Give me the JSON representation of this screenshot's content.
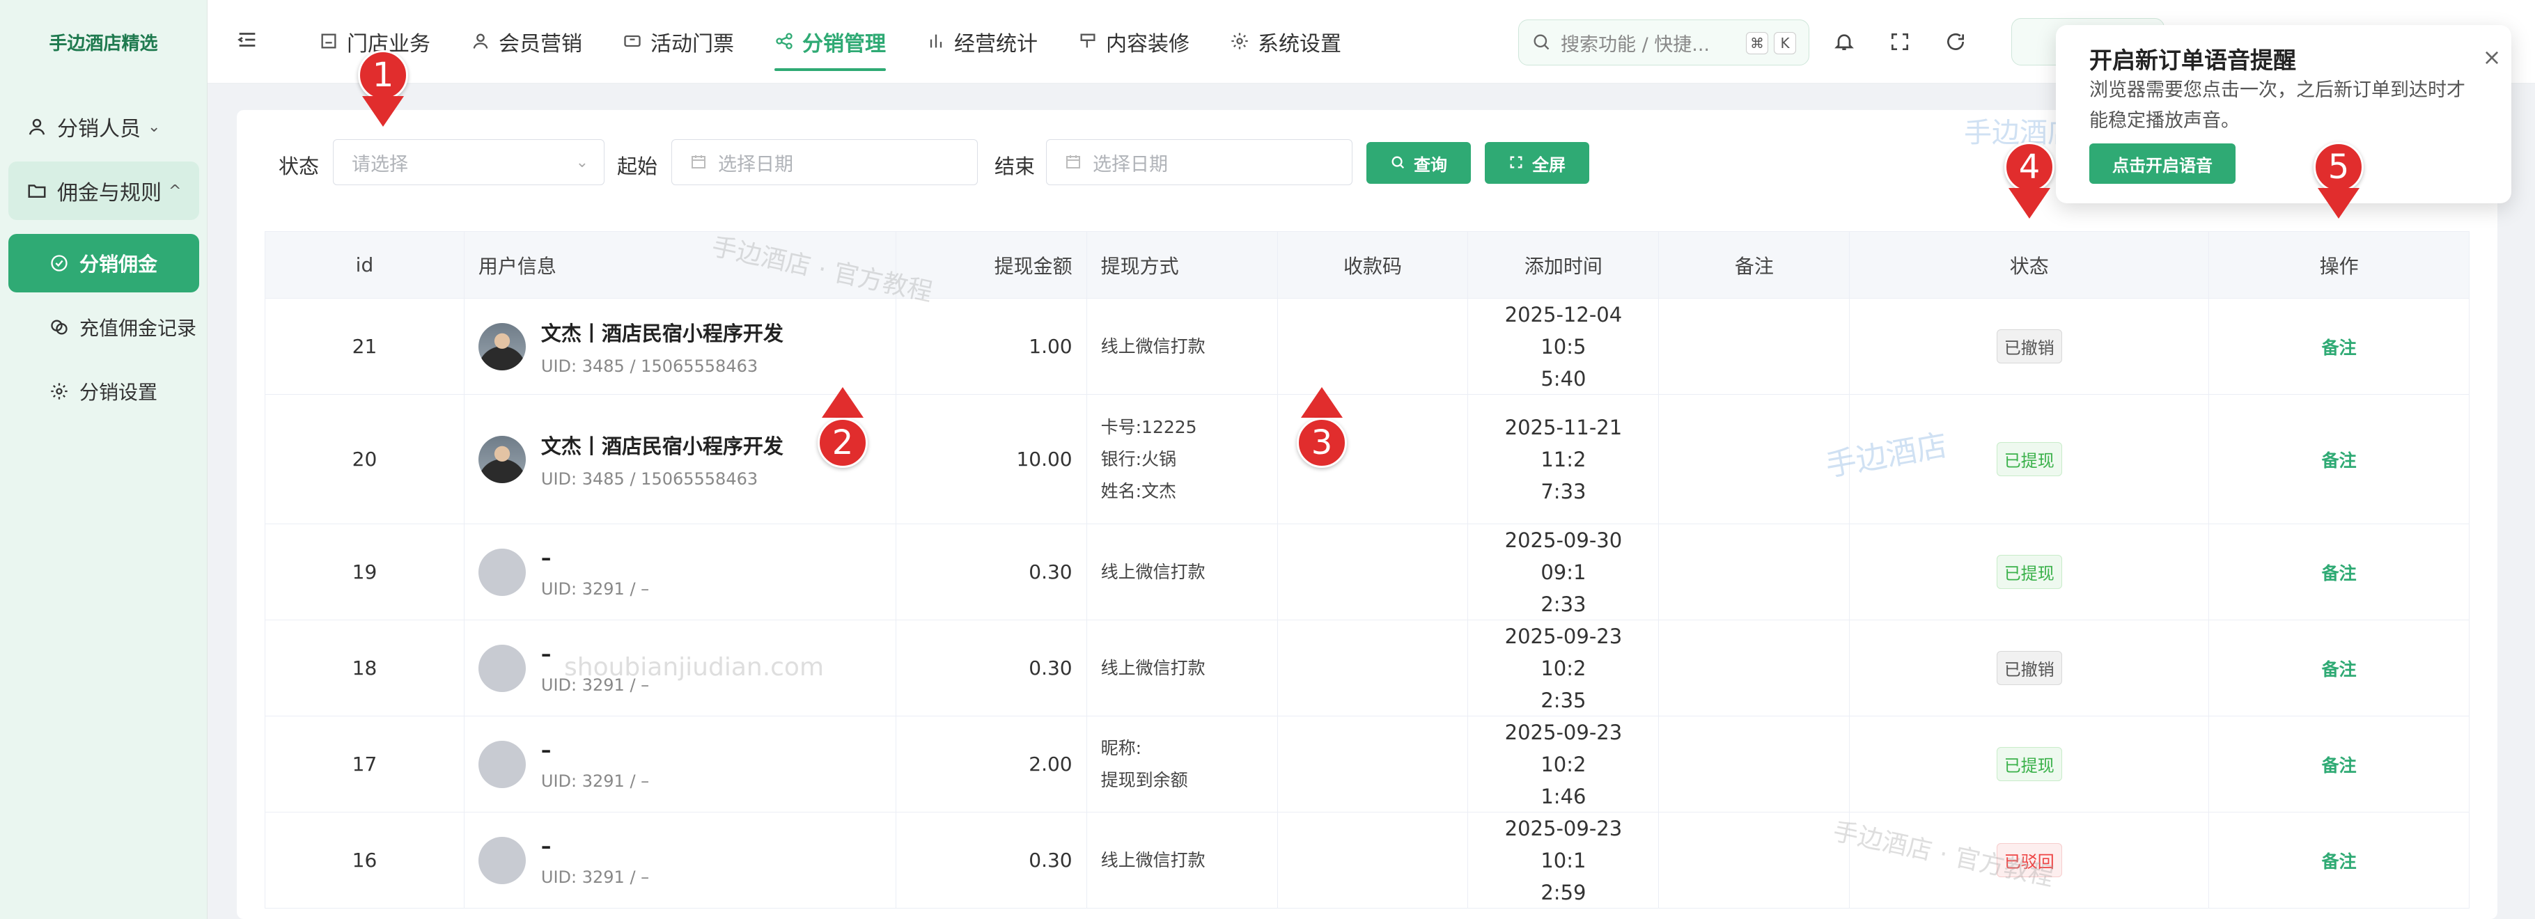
{
  "sidebar": {
    "brand": "手边酒店精选",
    "items": [
      {
        "label": "分销人员",
        "icon": "user-icon"
      },
      {
        "label": "佣金与规则",
        "icon": "folder-icon"
      },
      {
        "label": "分销佣金",
        "icon": "check-circle-icon"
      },
      {
        "label": "充值佣金记录",
        "icon": "coins-icon"
      },
      {
        "label": "分销设置",
        "icon": "gear-icon"
      }
    ],
    "group_chevron": "^",
    "first_chevron": "⌄"
  },
  "topnav": {
    "items": [
      {
        "label": "门店业务",
        "icon": "store-icon"
      },
      {
        "label": "会员营销",
        "icon": "user-icon"
      },
      {
        "label": "活动门票",
        "icon": "ticket-icon"
      },
      {
        "label": "分销管理",
        "icon": "share-icon"
      },
      {
        "label": "经营统计",
        "icon": "bar-chart-icon"
      },
      {
        "label": "内容装修",
        "icon": "brush-icon"
      },
      {
        "label": "系统设置",
        "icon": "gear-icon"
      }
    ],
    "active_index": 3,
    "search": {
      "placeholder": "搜索功能 / 快捷...",
      "kbd1": "⌘",
      "kbd2": "K"
    }
  },
  "filters": {
    "status_label": "状态",
    "status_placeholder": "请选择",
    "start_label": "起始",
    "start_placeholder": "选择日期",
    "end_label": "结束",
    "end_placeholder": "选择日期",
    "query_button": "查询",
    "fullscreen_button": "全屏"
  },
  "table": {
    "headers": [
      "id",
      "用户信息",
      "提现金额",
      "提现方式",
      "收款码",
      "添加时间",
      "备注",
      "状态",
      "操作"
    ],
    "rows": [
      {
        "id": "21",
        "name": "文杰丨酒店民宿小程序开发",
        "uid": "UID: 3485 / 15065558463",
        "amount": "1.00",
        "method1": "线上微信打款",
        "method2": "",
        "method3": "",
        "time1": "2025-12-04 10:5",
        "time2": "5:40",
        "status": "已撤销",
        "status_type": "revoked",
        "action": "备注",
        "photo": true
      },
      {
        "id": "20",
        "name": "文杰丨酒店民宿小程序开发",
        "uid": "UID: 3485 / 15065558463",
        "amount": "10.00",
        "method1": "卡号:12225",
        "method2": "银行:火锅",
        "method3": "姓名:文杰",
        "time1": "2025-11-21 11:2",
        "time2": "7:33",
        "status": "已提现",
        "status_type": "withdrawn",
        "action": "备注",
        "photo": true
      },
      {
        "id": "19",
        "name": "–",
        "uid": "UID: 3291 / –",
        "amount": "0.30",
        "method1": "线上微信打款",
        "method2": "",
        "method3": "",
        "time1": "2025-09-30 09:1",
        "time2": "2:33",
        "status": "已提现",
        "status_type": "withdrawn",
        "action": "备注",
        "photo": false
      },
      {
        "id": "18",
        "name": "–",
        "uid": "UID: 3291 / –",
        "amount": "0.30",
        "method1": "线上微信打款",
        "method2": "",
        "method3": "",
        "time1": "2025-09-23 10:2",
        "time2": "2:35",
        "status": "已撤销",
        "status_type": "revoked",
        "action": "备注",
        "photo": false
      },
      {
        "id": "17",
        "name": "–",
        "uid": "UID: 3291 / –",
        "amount": "2.00",
        "method1": "昵称:",
        "method2": "提现到余额",
        "method3": "",
        "time1": "2025-09-23 10:2",
        "time2": "1:46",
        "status": "已提现",
        "status_type": "withdrawn",
        "action": "备注",
        "photo": false
      },
      {
        "id": "16",
        "name": "–",
        "uid": "UID: 3291 / –",
        "amount": "0.30",
        "method1": "线上微信打款",
        "method2": "",
        "method3": "",
        "time1": "2025-09-23 10:1",
        "time2": "2:59",
        "status": "已驳回",
        "status_type": "rejected",
        "action": "备注",
        "photo": false
      }
    ]
  },
  "toast": {
    "title": "开启新订单语音提醒",
    "body": "浏览器需要您点击一次，之后新订单到达时才能稳定播放声音。",
    "button": "点击开启语音",
    "close": "×"
  },
  "watermarks": {
    "w1": "手边酒店 · 官方教程",
    "w2": "shoubianjiudian.com",
    "w3": "手边酒店",
    "w4": "手边酒店 · 官方教程",
    "w5": "手边酒店"
  },
  "markers": [
    "1",
    "2",
    "3",
    "4",
    "5"
  ],
  "colors": {
    "accent": "#2faa74",
    "marker": "#e12d2d"
  }
}
